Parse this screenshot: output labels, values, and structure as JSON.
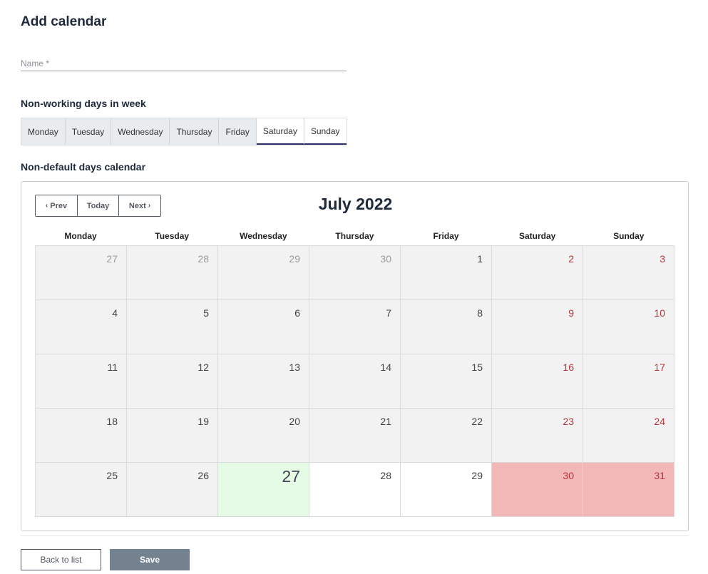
{
  "page": {
    "title": "Add calendar"
  },
  "form": {
    "name_placeholder": "Name *",
    "name_value": ""
  },
  "sections": {
    "nonworking_label": "Non-working days in week",
    "calendar_label": "Non-default days calendar"
  },
  "weekday_toggles": [
    {
      "label": "Monday",
      "selected": false
    },
    {
      "label": "Tuesday",
      "selected": false
    },
    {
      "label": "Wednesday",
      "selected": false
    },
    {
      "label": "Thursday",
      "selected": false
    },
    {
      "label": "Friday",
      "selected": false
    },
    {
      "label": "Saturday",
      "selected": true
    },
    {
      "label": "Sunday",
      "selected": true
    }
  ],
  "calendar": {
    "title": "July 2022",
    "nav": {
      "prev_label": "Prev",
      "today_label": "Today",
      "next_label": "Next"
    },
    "weekday_headers": [
      "Monday",
      "Tuesday",
      "Wednesday",
      "Thursday",
      "Friday",
      "Saturday",
      "Sunday"
    ],
    "weeks": [
      [
        "27",
        "28",
        "29",
        "30",
        "1",
        "2",
        "3"
      ],
      [
        "4",
        "5",
        "6",
        "7",
        "8",
        "9",
        "10"
      ],
      [
        "11",
        "12",
        "13",
        "14",
        "15",
        "16",
        "17"
      ],
      [
        "18",
        "19",
        "20",
        "21",
        "22",
        "23",
        "24"
      ],
      [
        "25",
        "26",
        "27",
        "28",
        "29",
        "30",
        "31"
      ]
    ]
  },
  "buttons": {
    "back_label": "Back to list",
    "save_label": "Save"
  },
  "colors": {
    "accent": "#2b2f6b",
    "weekend_text": "#b5343c",
    "today_bg": "#e6fbe6",
    "offday_bg": "#f2b8b8",
    "save_bg": "#748290"
  },
  "icons": {
    "prev": "chevron-left-icon",
    "next": "chevron-right-icon"
  }
}
